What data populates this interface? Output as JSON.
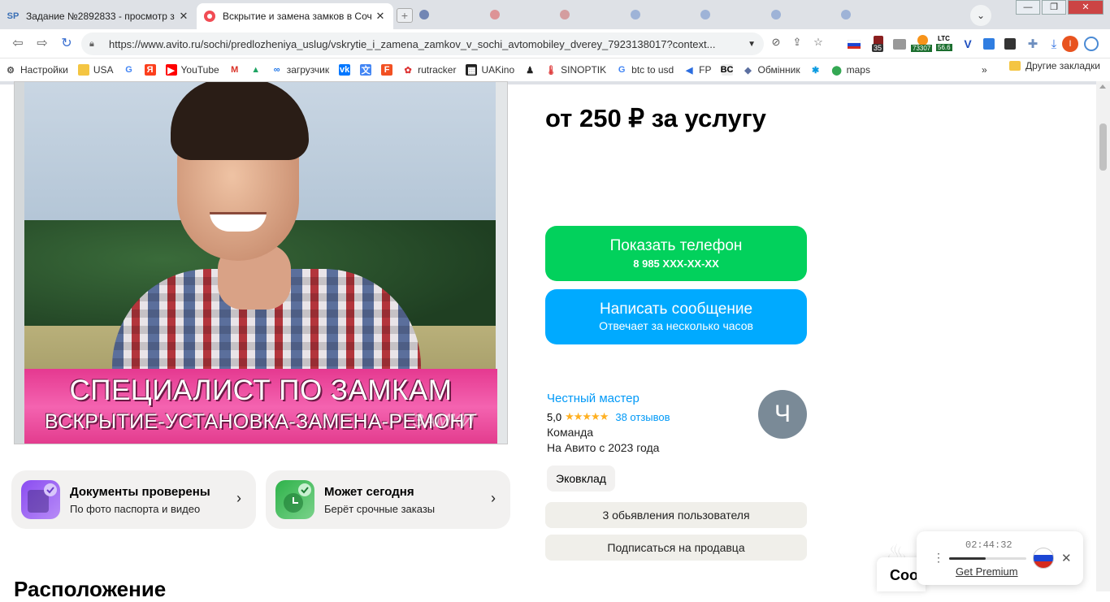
{
  "browser": {
    "tabs": [
      {
        "favicon": "SP",
        "title": "Задание №2892833 - просмотр з",
        "active": false
      },
      {
        "favicon": "avito-dot",
        "title": "Вскрытие и замена замков в Соч",
        "active": true
      }
    ],
    "url": "https://www.avito.ru/sochi/predlozheniya_uslug/vskrytie_i_zamena_zamkov_v_sochi_avtomobiley_dverey_7923138017?context...",
    "extensions": {
      "badge_35": "35",
      "ltc_label": "LTC",
      "ltc_value": "56.6",
      "btc_value": "73307"
    },
    "bookmarks": [
      {
        "icon": "gear-icon",
        "label": "Настройки"
      },
      {
        "icon": "folder-icon",
        "label": "USA"
      },
      {
        "icon": "google-icon",
        "label": ""
      },
      {
        "icon": "yandex-icon",
        "label": ""
      },
      {
        "icon": "youtube-icon",
        "label": "YouTube"
      },
      {
        "icon": "gmail-icon",
        "label": ""
      },
      {
        "icon": "drive-icon",
        "label": ""
      },
      {
        "icon": "loader-icon",
        "label": "загрузчик"
      },
      {
        "icon": "vk-icon",
        "label": ""
      },
      {
        "icon": "translate-icon",
        "label": ""
      },
      {
        "icon": "f-icon",
        "label": ""
      },
      {
        "icon": "rutracker-icon",
        "label": "rutracker"
      },
      {
        "icon": "uakino-icon",
        "label": "UAKino"
      },
      {
        "icon": "figure-icon",
        "label": ""
      },
      {
        "icon": "thermometer-icon",
        "label": "SINOPTIK"
      },
      {
        "icon": "google-icon",
        "label": "btc to usd"
      },
      {
        "icon": "fp-icon",
        "label": "FP"
      },
      {
        "icon": "bc-icon",
        "label": ""
      },
      {
        "icon": "exchange-icon",
        "label": "Обмінник"
      },
      {
        "icon": "star-icon",
        "label": ""
      },
      {
        "icon": "maps-icon",
        "label": "maps"
      }
    ],
    "bookmarks_more": "»",
    "other_bookmarks": "Другие закладки"
  },
  "listing": {
    "price": "от 250 ₽ за услугу",
    "photo": {
      "banner_line1": "СПЕЦИАЛИСТ ПО ЗАМКАМ",
      "banner_line2": "ВСКРЫТИЕ-УСТАНОВКА-ЗАМЕНА-РЕМОНТ",
      "watermark": "ЗАМКИ"
    },
    "badges": [
      {
        "title": "Документы проверены",
        "subtitle": "По фото паспорта и видео",
        "icon": "documents-verified-icon"
      },
      {
        "title": "Может сегодня",
        "subtitle": "Берёт срочные заказы",
        "icon": "clock-check-icon"
      }
    ],
    "show_phone": {
      "label": "Показать телефон",
      "number": "8 985 XXX-XX-XX"
    },
    "write_message": {
      "label": "Написать сообщение",
      "subtitle": "Отвечает за несколько часов"
    },
    "seller": {
      "name": "Честный мастер",
      "rating": "5,0",
      "stars": "★★★★★",
      "reviews": "38 отзывов",
      "type": "Команда",
      "since": "На Авито с 2023 года",
      "avatar_letter": "Ч",
      "tag": "Эковклад",
      "listings_button": "3 обьявления пользователя",
      "subscribe_button": "Подписаться на продавца"
    },
    "location_heading": "Расположение",
    "side_fragment": "Соо"
  },
  "player": {
    "time": "02:44:32",
    "progress": 0.47,
    "premium": "Get Premium",
    "close": "✕",
    "menu": "⋮"
  }
}
